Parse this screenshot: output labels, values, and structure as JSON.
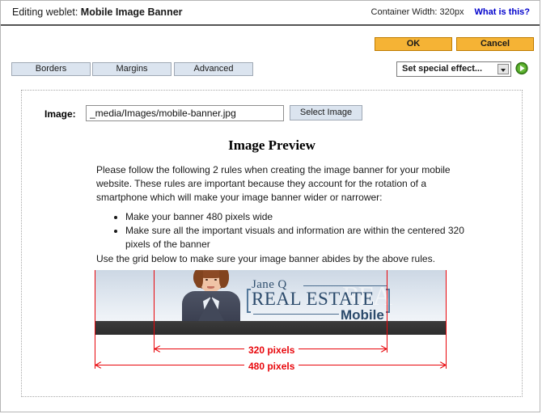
{
  "titlebar": {
    "prefix": "Editing weblet:",
    "weblet_name": "Mobile Image Banner",
    "container_width": "Container Width: 320px",
    "help_link": "What is this?"
  },
  "toolbar": {
    "ok_label": "OK",
    "cancel_label": "Cancel",
    "tabs": [
      {
        "label": "Borders"
      },
      {
        "label": "Margins"
      },
      {
        "label": "Advanced"
      }
    ],
    "effect_select": {
      "selected": "Set special effect...",
      "dropdown_icon": "chevron-down-icon",
      "go_icon": "green-play-icon"
    }
  },
  "panel": {
    "image_field": {
      "label": "Image:",
      "value": "_media/Images/mobile-banner.jpg",
      "placeholder": "",
      "button_label": "Select Image"
    },
    "preview_title": "Image Preview",
    "intro_paragraph": "Please follow the following 2 rules when creating the image banner for your mobile website. These rules are important because they account for the rotation of a smartphone which will make your image banner wider or narrower:",
    "rules": [
      "Make your banner 480 pixels wide",
      "Make sure all the important visuals and information are within the centered 320 pixels of the banner"
    ],
    "grid_note": "Use the grid below to make sure your image banner abides by the above rules."
  },
  "banner": {
    "logo": {
      "name_line": "Jane Q",
      "main_line": "REAL ESTATE",
      "sub_line": "Mobile",
      "ghost_text": "REA"
    },
    "measurements": {
      "inner_label": "320 pixels",
      "outer_label": "480 pixels",
      "guide_color": "#e8060b"
    }
  },
  "colors": {
    "accent_button": "#f5b335",
    "accent_button_border": "#c07c00",
    "tab_button": "#dbe4ef",
    "link": "#0000cc",
    "guide_red": "#e8060b"
  }
}
